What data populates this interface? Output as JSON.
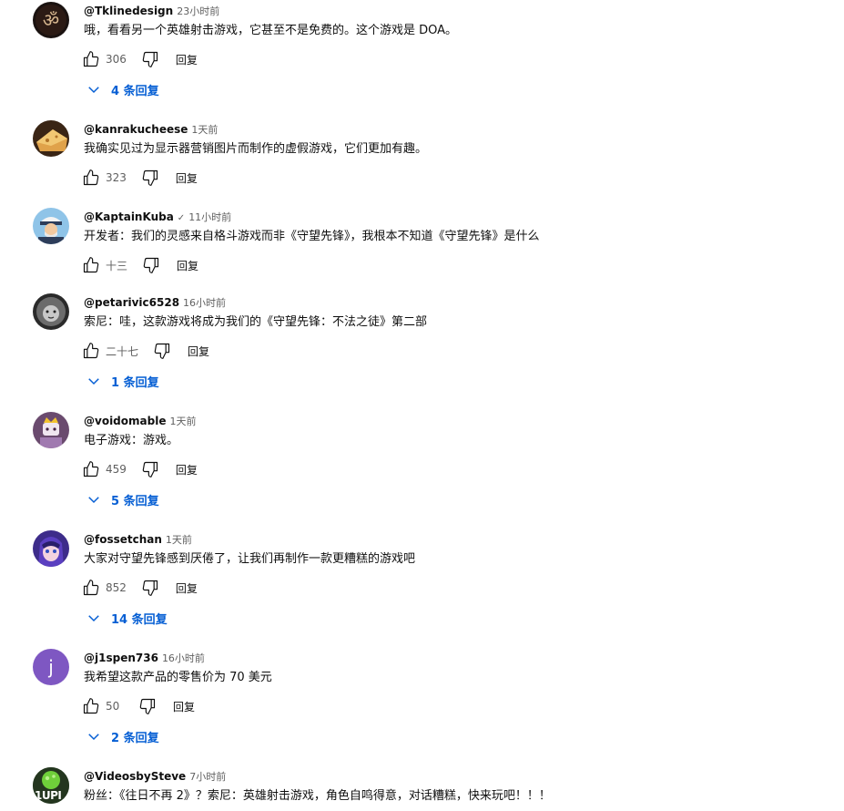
{
  "comments": [
    {
      "author": "@Tklinedesign",
      "time": "23小时前",
      "text": "哦，看看另一个英雄射击游戏，它甚至不是免费的。这个游戏是 DOA。",
      "likes": "306",
      "reply_label": "回复",
      "replies_label": "4 条回复",
      "avatar": "om-symbol-avatar"
    },
    {
      "author": "@kanrakucheese",
      "time": "1天前",
      "text": "我确实见过为显示器营销图片而制作的虚假游戏，它们更加有趣。",
      "likes": "323",
      "reply_label": "回复",
      "avatar": "cheese-avatar"
    },
    {
      "author": "@KaptainKuba",
      "verified": "✓",
      "time": "11小时前",
      "text": "开发者：我们的灵感来自格斗游戏而非《守望先锋》，我根本不知道《守望先锋》是什么",
      "likes": "十三",
      "reply_label": "回复",
      "avatar": "captain-avatar"
    },
    {
      "author": "@petarivic6528",
      "time": "16小时前",
      "text": "索尼：哇，这款游戏将成为我们的《守望先锋：不法之徒》第二部",
      "likes": "二十七",
      "reply_label": "回复",
      "replies_label": "1 条回复",
      "avatar": "lion-avatar"
    },
    {
      "author": "@voidomable",
      "time": "1天前",
      "text": "电子游戏：游戏。",
      "likes": "459",
      "reply_label": "回复",
      "replies_label": "5 条回复",
      "avatar": "king-avatar"
    },
    {
      "author": "@fossetchan",
      "time": "1天前",
      "text": "大家对守望先锋感到厌倦了，让我们再制作一款更糟糕的游戏吧",
      "likes": "852",
      "reply_label": "回复",
      "replies_label": "14 条回复",
      "avatar": "anime-avatar"
    },
    {
      "author": "@j1spen736",
      "time": "16小时前",
      "text": "我希望这款产品的零售价为 70 美元",
      "likes": "50",
      "reply_label": "回复",
      "replies_label": "2 条回复",
      "avatar": "letter-avatar",
      "avatar_letter": "j"
    },
    {
      "author": "@VideosbySteve",
      "time": "7小时前",
      "text": "粉丝：《往日不再 2》？索尼：英雄射击游戏，角色自鸣得意，对话糟糕，快来玩吧！！！",
      "avatar": "green-logo-avatar",
      "avatar_text": "1UPI"
    }
  ],
  "colors": {
    "link_blue": "#065fd4",
    "secondary_text": "#606060",
    "primary_text": "#0f0f0f",
    "letter_avatar_bg": "#7e57c2"
  },
  "icons": {
    "like": "thumbs-up-icon",
    "dislike": "thumbs-down-icon",
    "expand": "chevron-down-icon"
  }
}
